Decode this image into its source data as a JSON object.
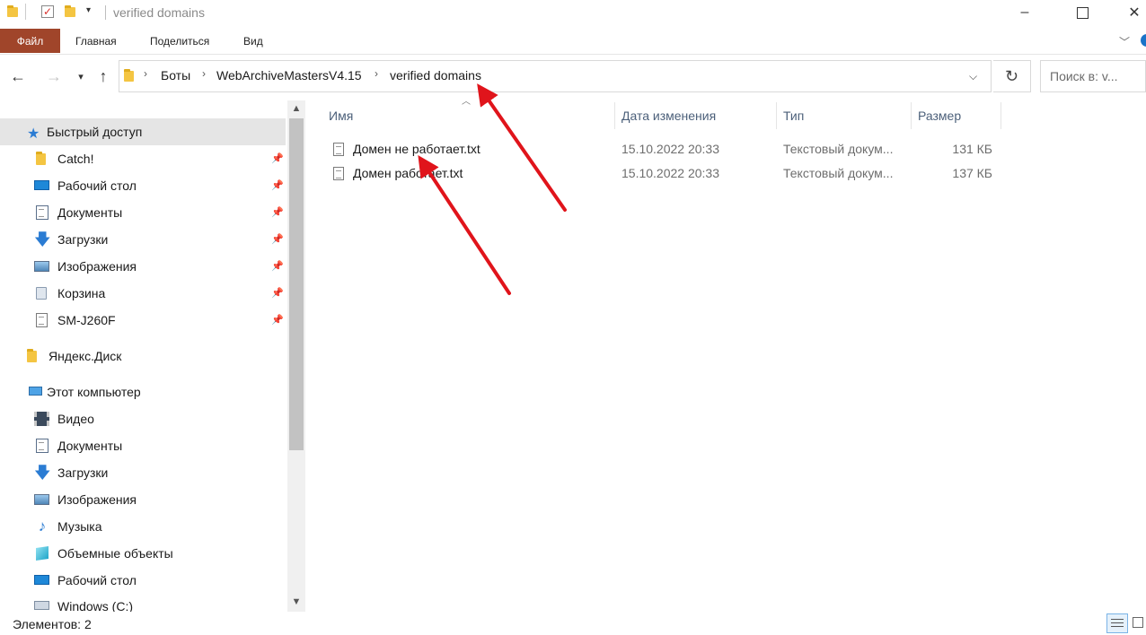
{
  "window": {
    "title": "verified domains"
  },
  "ribbon": {
    "tabs": [
      "Файл",
      "Главная",
      "Поделиться",
      "Вид"
    ]
  },
  "address": {
    "crumbs": [
      "Боты",
      "WebArchiveMastersV4.15",
      "verified domains"
    ]
  },
  "search": {
    "placeholder": "Поиск в: v..."
  },
  "sidebar": {
    "quick_access": "Быстрый доступ",
    "pinned": [
      "Catch!",
      "Рабочий стол",
      "Документы",
      "Загрузки",
      "Изображения",
      "Корзина",
      "SM-J260F"
    ],
    "yandex": "Яндекс.Диск",
    "this_pc": "Этот компьютер",
    "pc_items": [
      "Видео",
      "Документы",
      "Загрузки",
      "Изображения",
      "Музыка",
      "Объемные объекты",
      "Рабочий стол",
      "Windows (C:)"
    ]
  },
  "columns": {
    "name": "Имя",
    "date": "Дата изменения",
    "type": "Тип",
    "size": "Размер"
  },
  "files": [
    {
      "name": "Домен не работает.txt",
      "date": "15.10.2022 20:33",
      "type": "Текстовый докум...",
      "size": "131 КБ"
    },
    {
      "name": "Домен работает.txt",
      "date": "15.10.2022 20:33",
      "type": "Текстовый докум...",
      "size": "137 КБ"
    }
  ],
  "status": {
    "count": "Элементов: 2"
  },
  "colors": {
    "file_tab": "#a0452a",
    "selection": "#e5e5e5",
    "annotation_arrow": "#e0141b",
    "folder": "#f4c542"
  }
}
